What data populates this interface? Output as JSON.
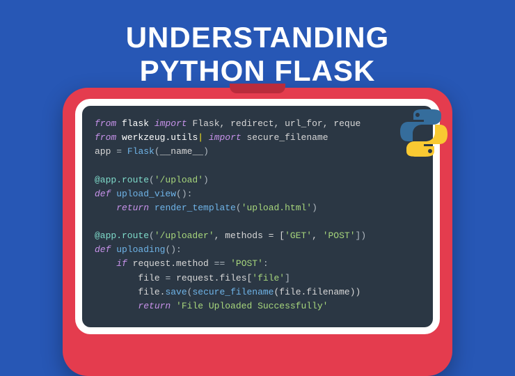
{
  "title_line1": "UNDERSTANDING",
  "title_line2": "PYTHON FLASK",
  "logo_name": "python-logo",
  "code": {
    "l1": {
      "kw1": "from",
      "mod1": "flask",
      "kw2": "import",
      "items": "Flask, redirect, url_for, reque"
    },
    "l2": {
      "kw1": "from",
      "mod1": "werkzeug.utils",
      "kw2": "import",
      "items": "secure_filename"
    },
    "l3": {
      "lhs": "app",
      "op": "=",
      "fn": "Flask",
      "arg": "__name__"
    },
    "l5": {
      "dec": "@app.route",
      "arg": "'/upload'"
    },
    "l6": {
      "kw": "def",
      "name": "upload_view",
      "paren": "():"
    },
    "l7": {
      "kw": "return",
      "fn": "render_template",
      "arg": "'upload.html'"
    },
    "l9": {
      "dec": "@app.route",
      "arg1": "'/uploader'",
      "mid": ", methods = [",
      "arg2": "'GET'",
      "sep": ", ",
      "arg3": "'POST'",
      "end": "])"
    },
    "l10": {
      "kw": "def",
      "name": "uploading",
      "paren": "():"
    },
    "l11": {
      "kw": "if",
      "expr": "request.method",
      "op": "==",
      "val": "'POST'",
      "end": ":"
    },
    "l12": {
      "lhs": "file",
      "op": "=",
      "rhs": "request.files[",
      "key": "'file'",
      "end": "]"
    },
    "l13": {
      "obj": "file.",
      "fn1": "save",
      "p1": "(",
      "fn2": "secure_filename",
      "p2": "(file.filename))"
    },
    "l14": {
      "kw": "return",
      "val": "'File Uploaded Successfully'"
    }
  }
}
